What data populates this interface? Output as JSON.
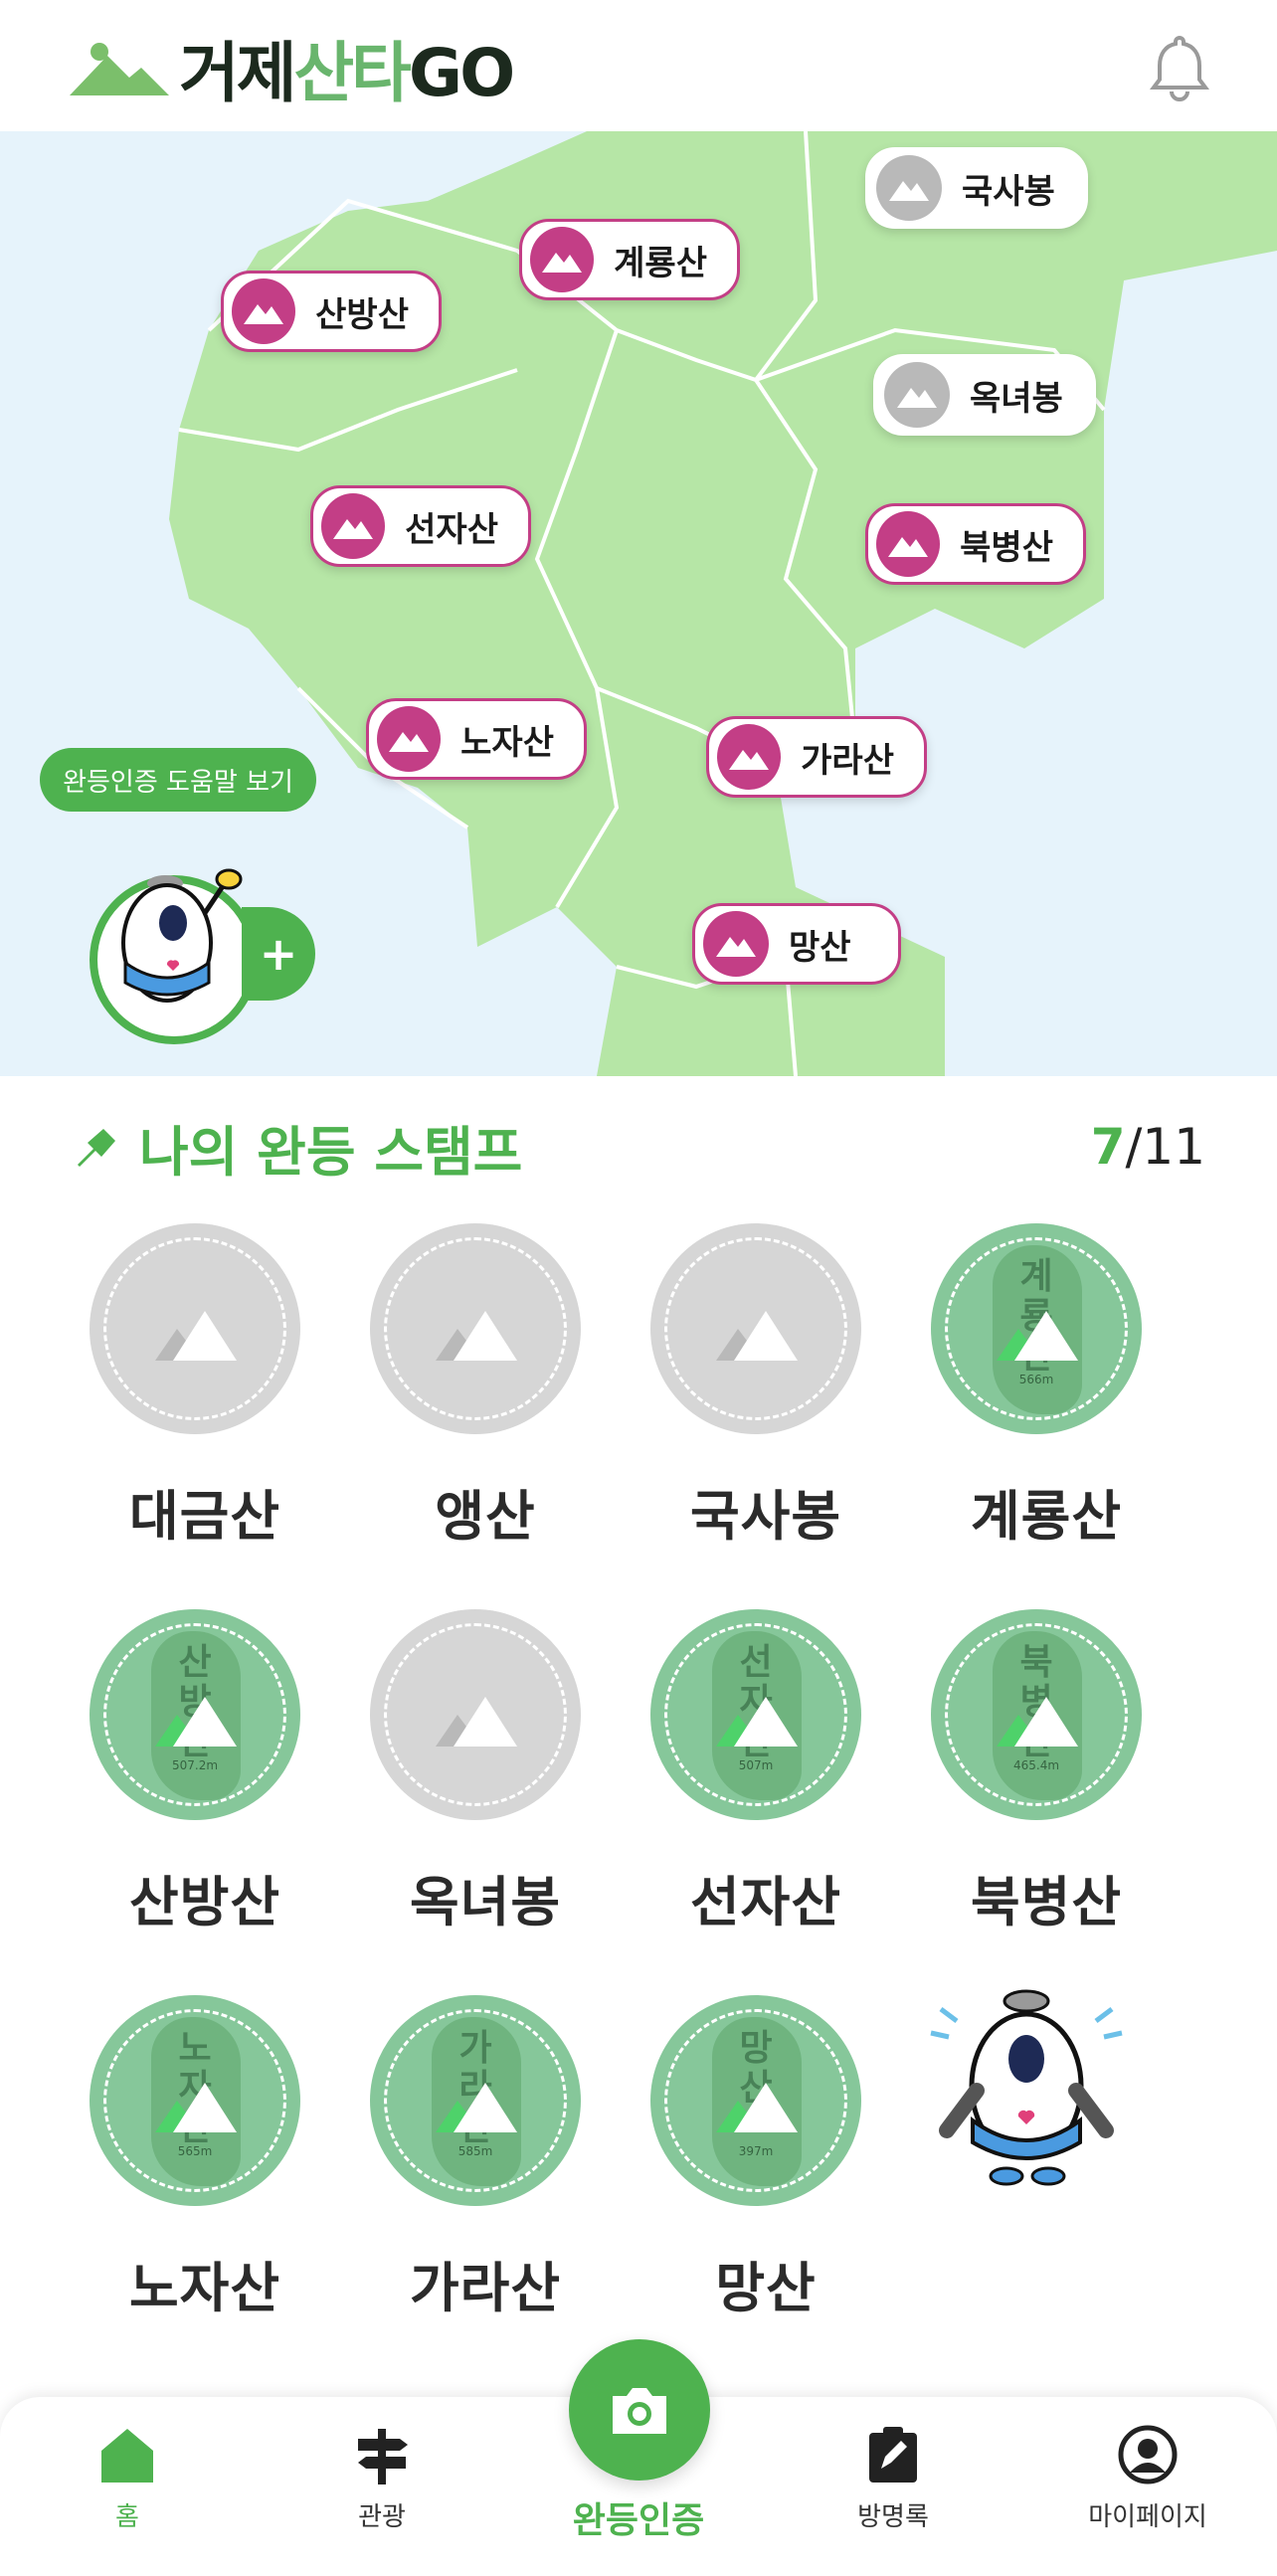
{
  "header": {
    "logo_part1": "거제",
    "logo_part2": "산타",
    "logo_part3": "GO"
  },
  "map": {
    "markers": [
      {
        "label": "국사봉",
        "status": "gray"
      },
      {
        "label": "계룡산",
        "status": "active"
      },
      {
        "label": "산방산",
        "status": "active"
      },
      {
        "label": "옥녀봉",
        "status": "gray"
      },
      {
        "label": "선자산",
        "status": "active"
      },
      {
        "label": "북병산",
        "status": "active"
      },
      {
        "label": "노자산",
        "status": "active"
      },
      {
        "label": "가라산",
        "status": "active"
      },
      {
        "label": "망산",
        "status": "active"
      }
    ],
    "help_label": "완등인증 도움말 보기"
  },
  "stamps": {
    "title": "나의 완등 스탬프",
    "completed": "7",
    "total": "/11",
    "items": [
      {
        "name": "대금산",
        "done": false
      },
      {
        "name": "앵산",
        "done": false
      },
      {
        "name": "국사봉",
        "done": false
      },
      {
        "name": "계룡산",
        "done": true,
        "rock_text": "계룡산",
        "elev": "566m"
      },
      {
        "name": "산방산",
        "done": true,
        "rock_text": "산방산",
        "elev": "507.2m"
      },
      {
        "name": "옥녀봉",
        "done": false
      },
      {
        "name": "선자산",
        "done": true,
        "rock_text": "선자산",
        "elev": "507m"
      },
      {
        "name": "북병산",
        "done": true,
        "rock_text": "북병산",
        "elev": "465.4m"
      },
      {
        "name": "노자산",
        "done": true,
        "rock_text": "노자산",
        "elev": "565m"
      },
      {
        "name": "가라산",
        "done": true,
        "rock_text": "가라산",
        "elev": "585m"
      },
      {
        "name": "망산",
        "done": true,
        "rock_text": "망산",
        "elev": "397m"
      }
    ]
  },
  "tabbar": {
    "home": "홈",
    "tour": "관광",
    "certify": "완등인증",
    "guestbook": "방명록",
    "mypage": "마이페이지"
  },
  "colors": {
    "primary_green": "#4eb24f",
    "marker_pink": "#c33e86",
    "land": "#b6e6a6",
    "sea": "#e6f3fb"
  }
}
